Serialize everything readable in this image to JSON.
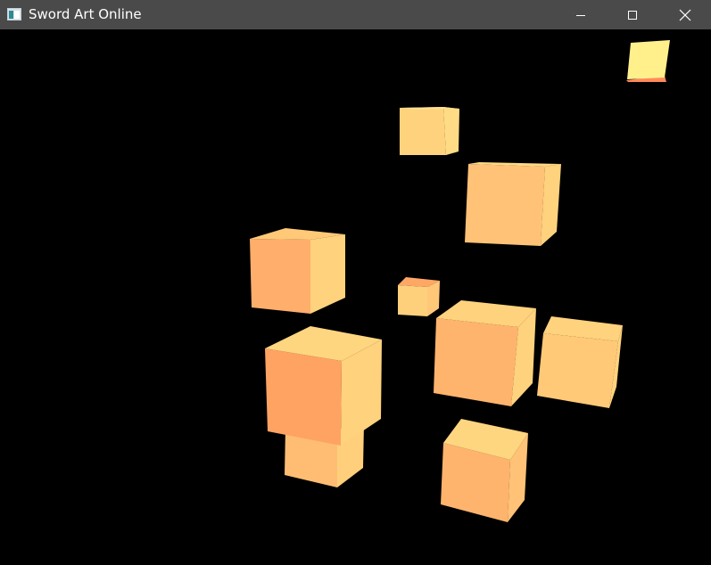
{
  "window": {
    "title": "Sword Art Online"
  },
  "titlebar": {
    "app_icon": "application-window-icon",
    "buttons": {
      "minimize": "minimize-icon",
      "maximize": "maximize-icon",
      "close": "close-icon"
    }
  },
  "scene": {
    "background": "#000000",
    "object_count": 11,
    "object_kind": "cube",
    "palette": [
      "#ffad6b",
      "#ffb870",
      "#ffc97a",
      "#ffdb85",
      "#fff08c"
    ]
  }
}
